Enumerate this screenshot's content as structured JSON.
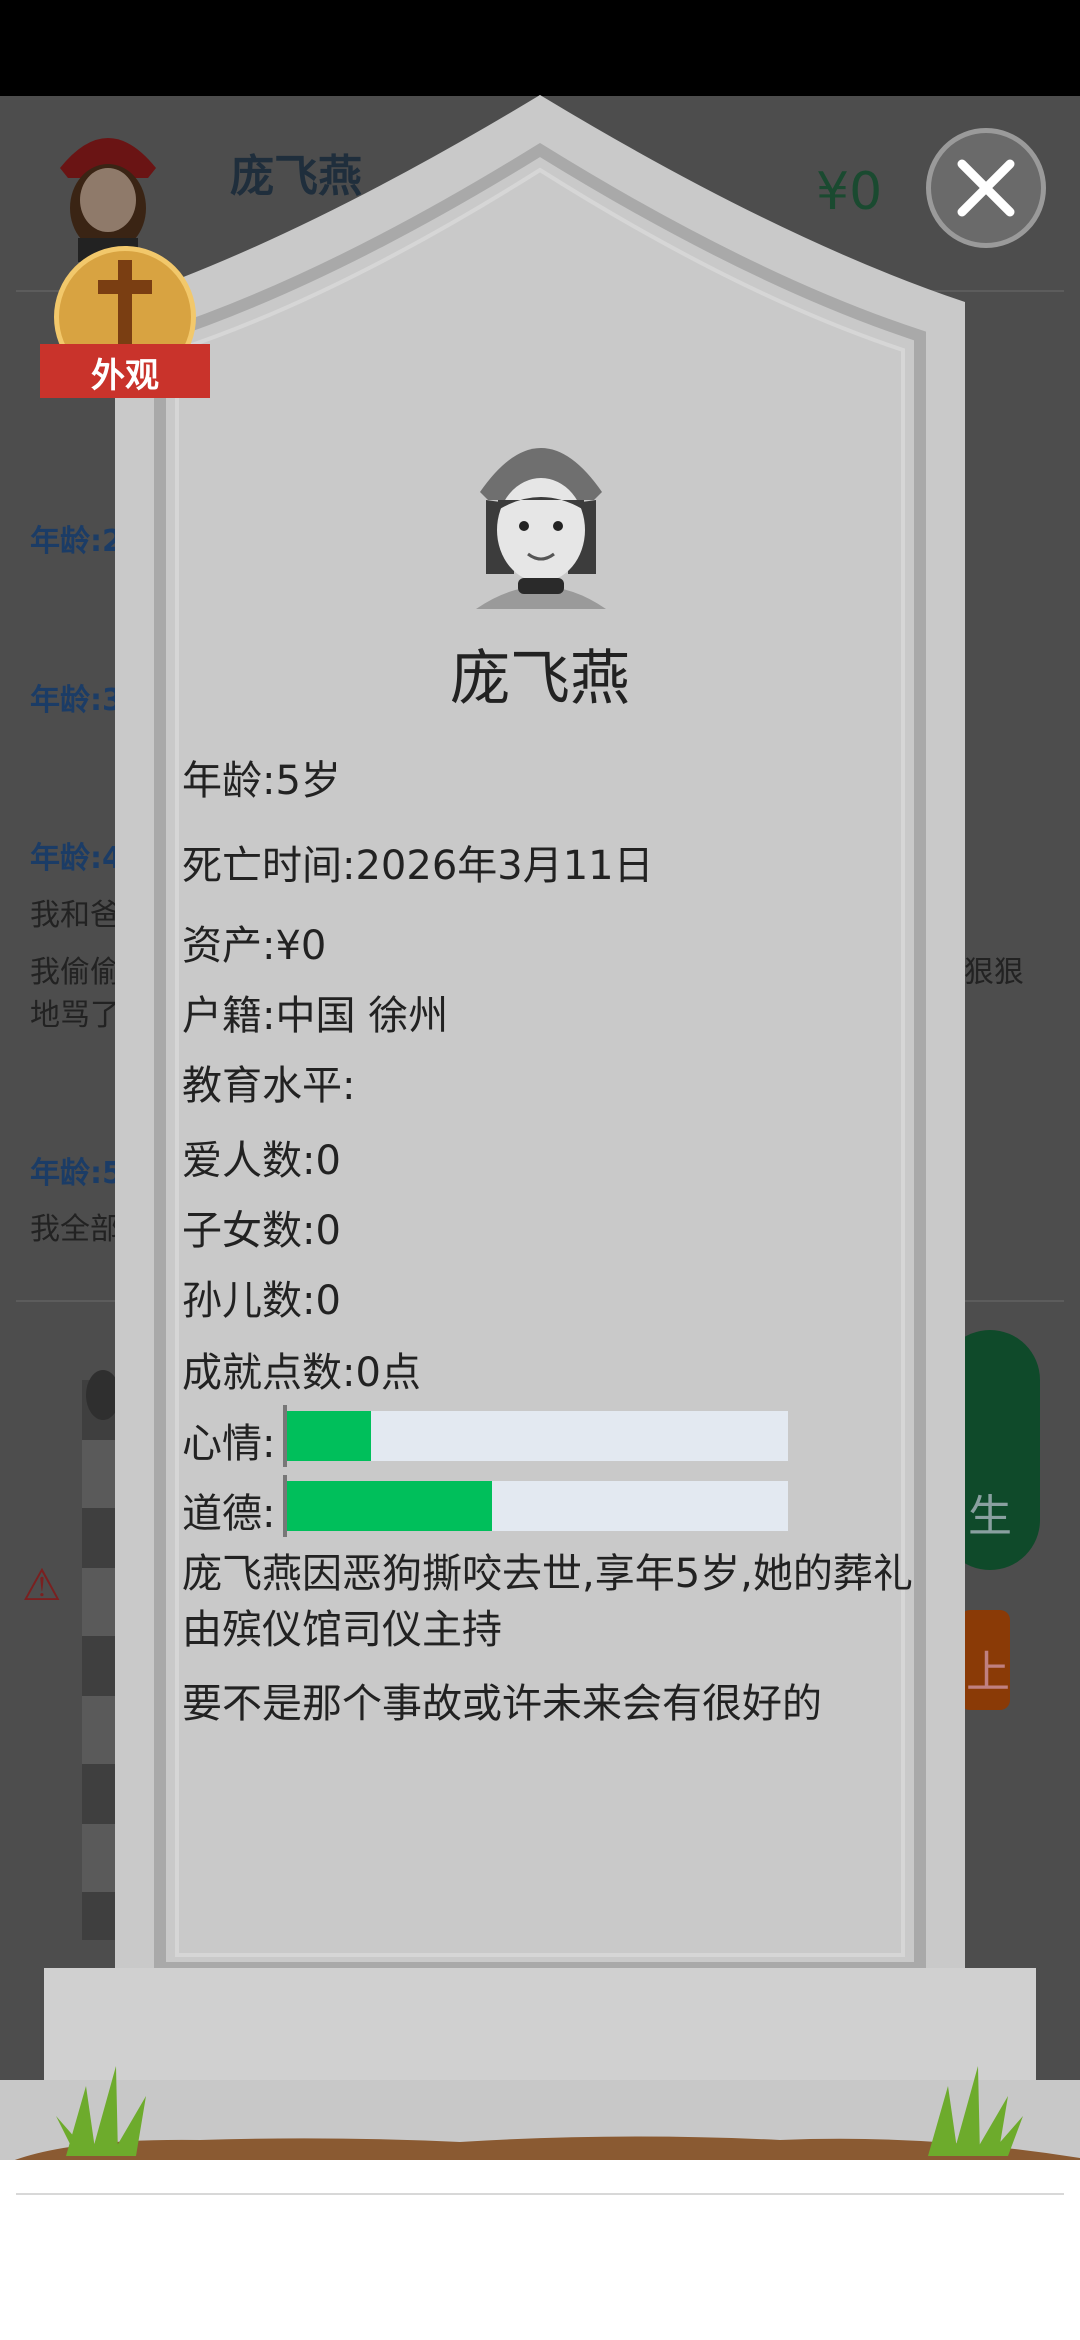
{
  "background_game": {
    "player_name": "庞飞燕",
    "money": "¥0",
    "age_labels": [
      "年龄:2",
      "年龄:3",
      "年龄:4",
      "年龄:5"
    ],
    "event_lines": [
      "我和爸",
      "我偷偷",
      "地骂了",
      "我全部",
      "狠狠"
    ],
    "button_text": "生",
    "orange_button_text": "上"
  },
  "badge": {
    "label": "外观",
    "icon": "cross-icon"
  },
  "close_button": {
    "icon": "close-icon"
  },
  "tombstone": {
    "name": "庞飞燕",
    "lines": [
      "年龄:5岁",
      "死亡时间:2026年3月11日",
      "资产:¥0",
      "户籍:中国 徐州",
      "教育水平:",
      "爱人数:0",
      "子女数:0",
      "孙儿数:0",
      "成就点数:0点"
    ],
    "mood_label": "心情:",
    "mood_value": 0.17,
    "morality_label": "道德:",
    "morality_value": 0.41,
    "epitaph": "庞飞燕因恶狗撕咬去世,享年5岁,她的葬礼由殡仪馆司仪主持",
    "epitaph2": "要不是那个事故或许未来会有很好的"
  },
  "colors": {
    "tombstone": "#c9c9c9",
    "bar_fill": "#00bf5b",
    "bar_track": "#e3e9f1",
    "badge_gold": "#d8a341",
    "ribbon_red": "#c9332b"
  }
}
